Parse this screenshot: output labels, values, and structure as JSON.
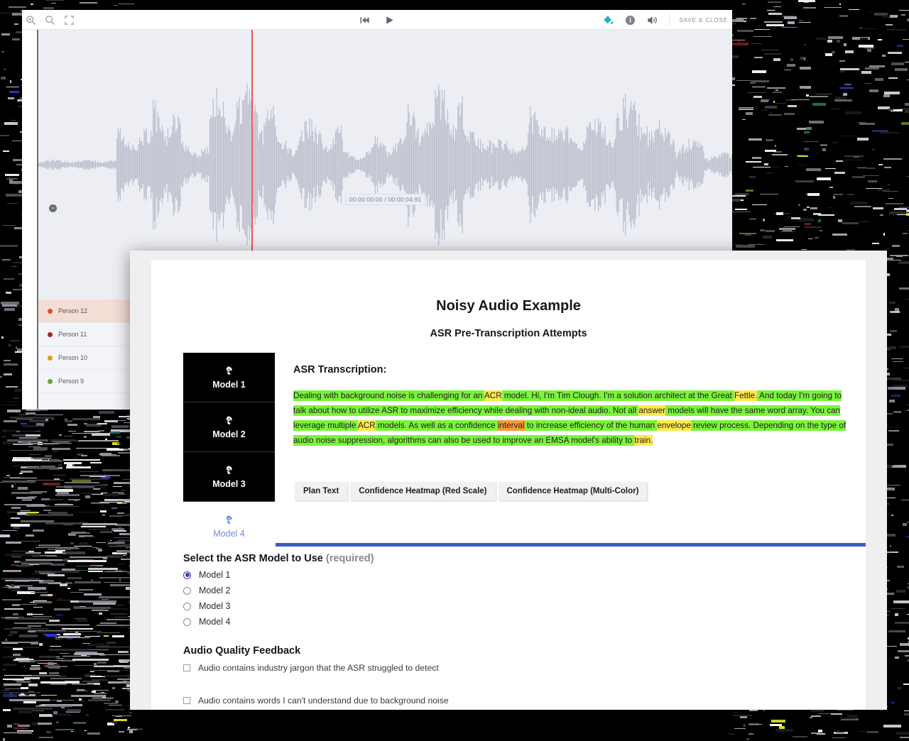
{
  "audio_editor": {
    "toolbar": {
      "zoom_in_icon": "zoom-in-icon",
      "zoom_out_icon": "zoom-out-icon",
      "fit_screen_icon": "fit-to-screen-icon",
      "rewind_icon": "rewind-to-start-icon",
      "play_icon": "play-icon",
      "paint_icon": "paint-bucket-icon",
      "info_icon": "info-icon",
      "volume_icon": "volume-icon",
      "save_close_label": "SAVE & CLOSE"
    },
    "timecode": "00:00:00:00 / 00:00:04:91",
    "zoom_handle_glyph": "−",
    "speakers": [
      {
        "label": "Person 12",
        "color": "#d8502a",
        "active": true
      },
      {
        "label": "Person 11",
        "color": "#a12b22",
        "active": false
      },
      {
        "label": "Person 10",
        "color": "#dd9a1e",
        "active": false
      },
      {
        "label": "Person 9",
        "color": "#6f9d42",
        "active": false
      }
    ]
  },
  "dialog": {
    "title": "Noisy Audio Example",
    "subtitle": "ASR Pre-Transcription Attempts",
    "model_tabs": [
      {
        "label": "Model 1",
        "icon": "head-gear-icon",
        "style": "dark"
      },
      {
        "label": "Model 2",
        "icon": "head-gear-icon",
        "style": "dark"
      },
      {
        "label": "Model 3",
        "icon": "head-gear-icon",
        "style": "dark"
      },
      {
        "label": "Model 4",
        "icon": "head-gear-icon",
        "style": "light"
      }
    ],
    "transcription_heading": "ASR Transcription:",
    "transcription_tokens": [
      {
        "text": "Dealing with background noise is challenging for an ",
        "hl": "green"
      },
      {
        "text": "ACR",
        "hl": "yellow"
      },
      {
        "text": " model. Hi, I'm Tim Clough. I'm a solution architect at the Great ",
        "hl": "green"
      },
      {
        "text": "Fettle.",
        "hl": "yellow"
      },
      {
        "text": " And today I'm going to talk about how to utilize ASR to maximize efficiency while dealing with non-ideal audio. Not all ",
        "hl": "green"
      },
      {
        "text": "answer",
        "hl": "yellow"
      },
      {
        "text": " models will have the same word array. You can leverage multiple ",
        "hl": "green"
      },
      {
        "text": "ACR",
        "hl": "yellow"
      },
      {
        "text": " models. As well as a confidence ",
        "hl": "green"
      },
      {
        "text": "interval",
        "hl": "orange"
      },
      {
        "text": " to increase efficiency of the human ",
        "hl": "green"
      },
      {
        "text": "envelope",
        "hl": "yellow"
      },
      {
        "text": " review process. Depending on the type of audio noise suppression, algorithms can also be used to improve an EMSA model's ability to ",
        "hl": "green"
      },
      {
        "text": "train.",
        "hl": "yellow"
      }
    ],
    "view_buttons": [
      {
        "label": "Plan Text"
      },
      {
        "label": "Confidence Heatmap (Red Scale)"
      },
      {
        "label": "Confidence Heatmap (Multi-Color)"
      }
    ],
    "model_select": {
      "heading": "Select the ASR Model to Use",
      "required_suffix": "(required)",
      "options": [
        {
          "label": "Model 1",
          "checked": true
        },
        {
          "label": "Model 2",
          "checked": false
        },
        {
          "label": "Model 3",
          "checked": false
        },
        {
          "label": "Model 4",
          "checked": false
        }
      ]
    },
    "audio_quality": {
      "heading": "Audio Quality Feedback",
      "options": [
        {
          "label": "Audio contains industry jargon that the ASR struggled to detect",
          "checked": false
        },
        {
          "label": "Audio contains words I can't understand due to background noise",
          "checked": false
        }
      ]
    },
    "accent_color": "#3a5cc0",
    "highlight_colors": {
      "green": "#7bf43c",
      "yellow": "#ffe94d",
      "orange": "#f79b3a"
    }
  }
}
